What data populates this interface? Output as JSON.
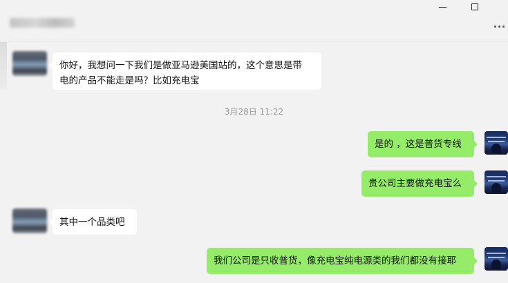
{
  "window": {
    "minimize_icon": "minimize-icon",
    "maximize_icon": "maximize-icon",
    "more_icon": "more-options-icon"
  },
  "messages": [
    {
      "from": "peer",
      "line1": "你好，我想问一下我们是做亚马逊美国站的，这个意思是带",
      "line2": "电的产品不能走是吗？比如充电宝"
    },
    {
      "timestamp": "3月28日 11:22"
    },
    {
      "from": "self",
      "text": "是的 ，这是普货专线"
    },
    {
      "from": "self",
      "text": "贵公司主要做充电宝么"
    },
    {
      "from": "peer",
      "text": "其中一个品类吧"
    },
    {
      "from": "self",
      "text": "我们公司是只收普货，像充电宝纯电源类的我们都没有接耶"
    }
  ],
  "colors": {
    "background": "#f2f2f2",
    "incoming_bubble": "#ffffff",
    "outgoing_bubble": "#95ec69",
    "timestamp_text": "#9a9a9a"
  }
}
